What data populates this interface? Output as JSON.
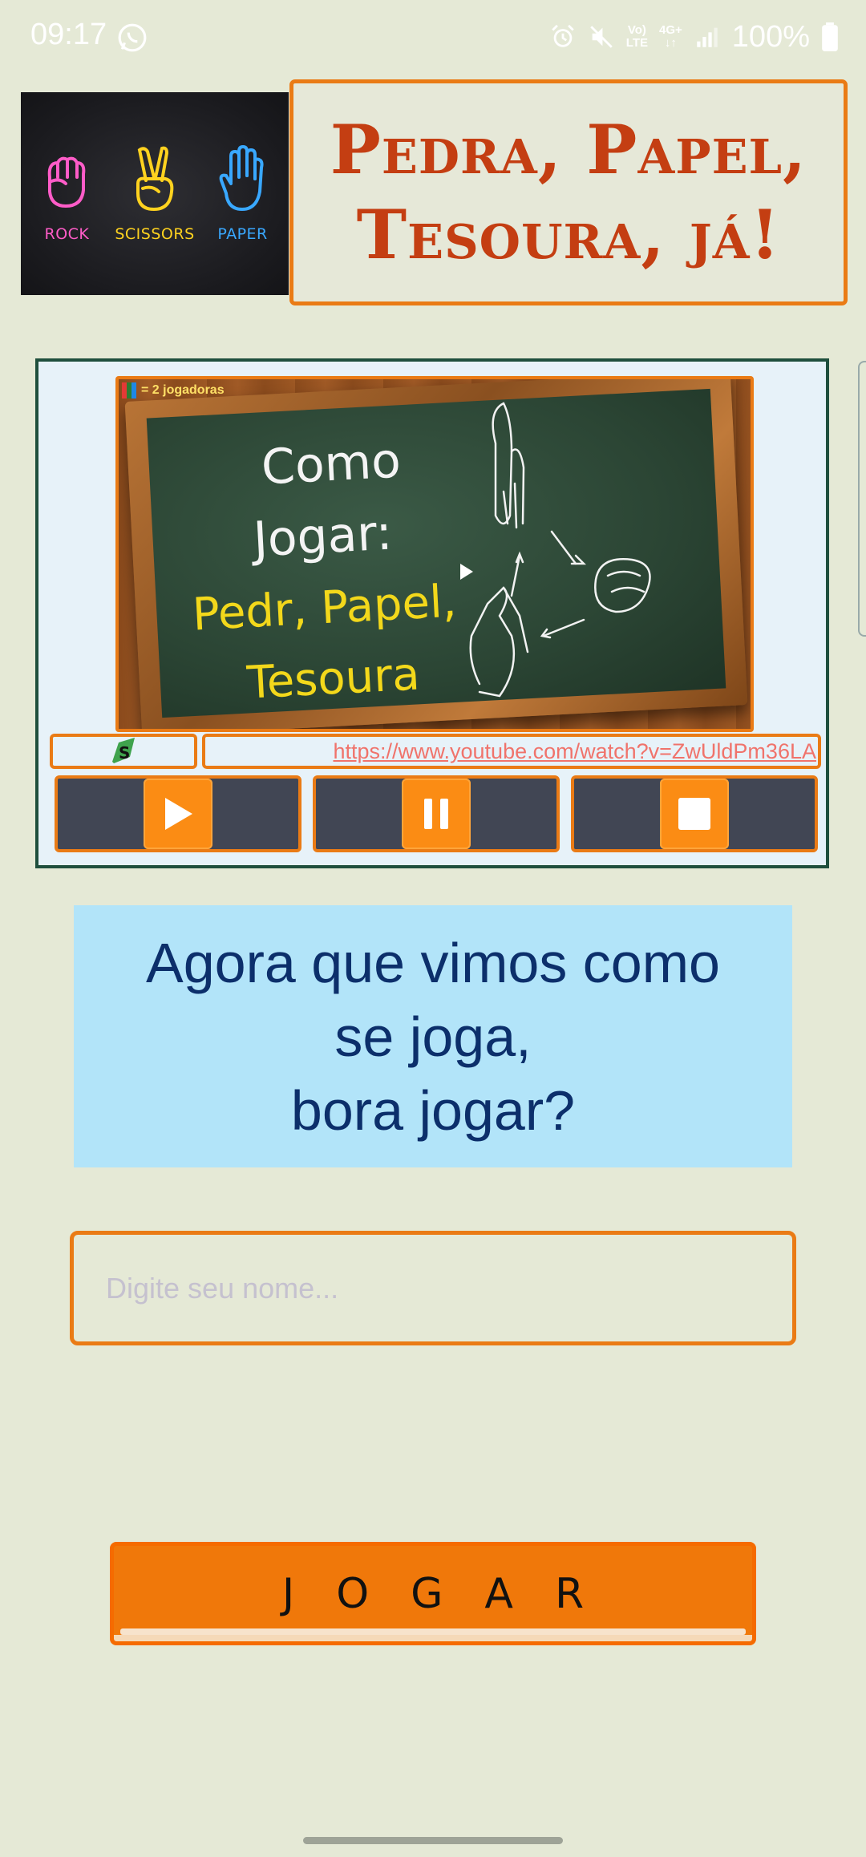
{
  "status_bar": {
    "time": "09:17",
    "network_top": "Vo)",
    "network_bottom": "LTE",
    "net_type": "4G+",
    "battery": "100%"
  },
  "header": {
    "logo": {
      "items": [
        {
          "label": "ROCK",
          "color": "#ff5cc8",
          "icon": "fist-icon"
        },
        {
          "label": "SCISSORS",
          "color": "#ffd21f",
          "icon": "peace-hand-icon"
        },
        {
          "label": "PAPER",
          "color": "#39a8ff",
          "icon": "open-hand-icon"
        }
      ]
    },
    "title_line1": "Pedra, Papel,",
    "title_line2": "Tesoura, já!"
  },
  "video": {
    "badge": "= 2 jogadoras",
    "chalk_line1": "Como",
    "chalk_line2": "Jogar:",
    "chalk_line3": "Pedr, Papel,",
    "chalk_line4": "Tesoura",
    "url": "https://www.youtube.com/watch?v=ZwUldPm36LA",
    "controls": [
      {
        "name": "play",
        "icon": "play-icon"
      },
      {
        "name": "pause",
        "icon": "pause-icon"
      },
      {
        "name": "stop",
        "icon": "stop-icon"
      }
    ]
  },
  "prompt": {
    "line1": "Agora que vimos como",
    "line2": "se joga,",
    "line3": "bora jogar?"
  },
  "name_input": {
    "placeholder": "Digite seu nome...",
    "value": ""
  },
  "play_button": {
    "label": "JOGAR"
  },
  "colors": {
    "background": "#e5e9d6",
    "accent": "#ea7b15",
    "title": "#c43e12",
    "prompt_bg": "#b2e4f9",
    "prompt_text": "#0c2f6b"
  }
}
